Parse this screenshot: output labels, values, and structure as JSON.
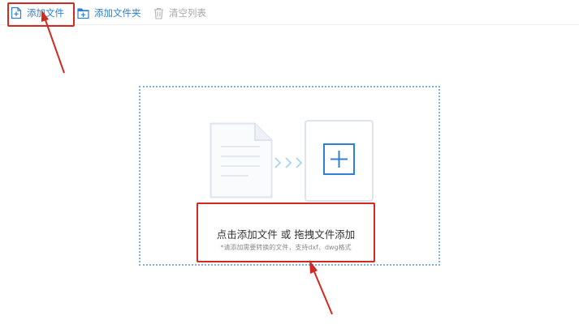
{
  "toolbar": {
    "add_file_label": "添加文件",
    "add_folder_label": "添加文件夹",
    "clear_list_label": "清空列表"
  },
  "dropzone": {
    "title": "点击添加文件 或 拖拽文件添加",
    "hint": "*请添加需要转换的文件，支持dxf、dwg格式"
  },
  "colors": {
    "accent": "#2f7fd6",
    "annotation_red": "#d02a22",
    "dropzone_border": "#7fb0e2",
    "disabled_text": "#a6a6a6"
  },
  "icons": {
    "add_file": "file-plus-icon",
    "add_folder": "folder-plus-icon",
    "clear_list": "trash-icon",
    "document": "document-icon",
    "arrow": "chevrons-right-icon",
    "plus": "plus-box-icon"
  }
}
